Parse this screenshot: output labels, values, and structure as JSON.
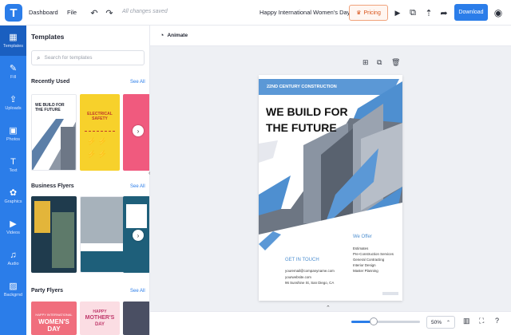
{
  "app": {
    "logo_letter": "T",
    "accent": "#2b7de9"
  },
  "topbar": {
    "dashboard": "Dashboard",
    "file": "File",
    "saved_status": "All changes saved",
    "doc_title": "Happy International Women's Day",
    "pricing": "Pricing",
    "download": "Download"
  },
  "rail": [
    {
      "label": "Templates",
      "icon": "templates-icon",
      "glyph": "▦"
    },
    {
      "label": "Fill",
      "icon": "fill-icon",
      "glyph": "✎"
    },
    {
      "label": "Uploads",
      "icon": "upload-icon",
      "glyph": "⇪"
    },
    {
      "label": "Photos",
      "icon": "photo-icon",
      "glyph": "▣"
    },
    {
      "label": "Text",
      "icon": "text-icon",
      "glyph": "T"
    },
    {
      "label": "Graphics",
      "icon": "graphics-icon",
      "glyph": "✿"
    },
    {
      "label": "Videos",
      "icon": "video-icon",
      "glyph": "▶"
    },
    {
      "label": "Audio",
      "icon": "audio-icon",
      "glyph": "♫"
    },
    {
      "label": "Backgrnd",
      "icon": "background-icon",
      "glyph": "▨"
    }
  ],
  "panel": {
    "title": "Templates",
    "search_placeholder": "Search for templates",
    "sections": [
      {
        "title": "Recently Used",
        "see_all": "See All"
      },
      {
        "title": "Business Flyers",
        "see_all": "See All"
      },
      {
        "title": "Party Flyers",
        "see_all": "See All"
      }
    ],
    "thumbs": {
      "recent1_title": "WE BUILD FOR THE FUTURE",
      "recent2_title": "ELECTRICAL SAFETY",
      "party1_line1": "HAPPY INTERNATIONAL",
      "party1_line2": "WOMEN'S DAY",
      "party2_line1": "HAPPY",
      "party2_line2": "MOTHER'S",
      "party2_line3": "DAY"
    }
  },
  "canvas": {
    "animate": "Animate",
    "poster": {
      "banner": "22ND CENTURY CONSTRUCTION",
      "headline1": "WE BUILD FOR",
      "headline2": "THE FUTURE",
      "offer_title": "We Offer",
      "offers": [
        "Estimates",
        "Pre-Construction Services",
        "General Contracting",
        "Interior Design",
        "Master Planning"
      ],
      "contact_title": "GET IN TOUCH",
      "contacts": [
        "youremail@companyname.com",
        "yourwebsite.com",
        "96 Sunshine St, San Diego, CA"
      ]
    }
  },
  "zoom": {
    "value": "50%",
    "level": 0.33
  }
}
